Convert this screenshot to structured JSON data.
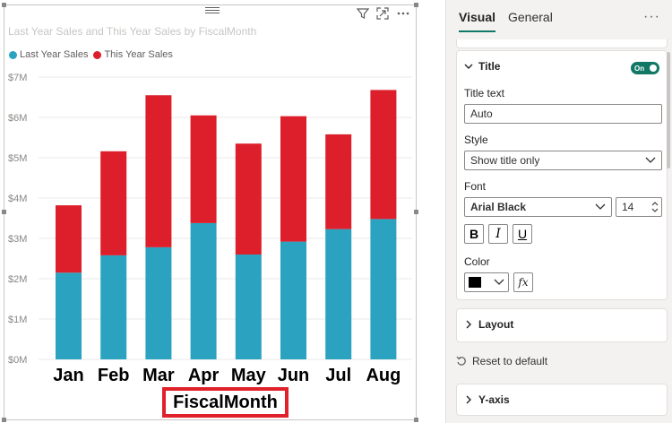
{
  "visual": {
    "title": "Last Year Sales and This Year Sales by FiscalMonth",
    "x_axis_title": "FiscalMonth"
  },
  "icons": {
    "filter": "filter-icon",
    "focus": "focus-mode-icon",
    "more": "more-options-icon",
    "grip": "drag-grip-icon"
  },
  "chart_data": {
    "type": "bar",
    "stacked": true,
    "title": "Last Year Sales and This Year Sales by FiscalMonth",
    "xlabel": "FiscalMonth",
    "ylabel": "",
    "categories": [
      "Jan",
      "Feb",
      "Mar",
      "Apr",
      "May",
      "Jun",
      "Jul",
      "Aug"
    ],
    "series": [
      {
        "name": "Last Year Sales",
        "color": "#2ba3c0",
        "values": [
          2.15,
          2.58,
          2.78,
          3.38,
          2.6,
          2.92,
          3.23,
          3.48
        ]
      },
      {
        "name": "This Year Sales",
        "color": "#dc1f2b",
        "values": [
          1.67,
          2.58,
          3.77,
          2.67,
          2.75,
          3.11,
          2.35,
          3.2
        ]
      }
    ],
    "value_unit": "$M",
    "ylim": [
      0,
      7
    ],
    "yticks": [
      "$0M",
      "$1M",
      "$2M",
      "$3M",
      "$4M",
      "$5M",
      "$6M",
      "$7M"
    ],
    "grid": true,
    "legend_position": "top-left"
  },
  "pane": {
    "tabs": [
      "Visual",
      "General"
    ],
    "more_label": "···",
    "title_section": {
      "header": "Title",
      "toggle_label": "On",
      "title_text_label": "Title text",
      "title_text_value": "Auto",
      "style_label": "Style",
      "style_value": "Show title only",
      "font_label": "Font",
      "font_family_value": "Arial Black",
      "font_size_value": "14",
      "bold_label": "B",
      "italic_label": "I",
      "underline_label": "U",
      "color_label": "Color",
      "color_value": "#000000",
      "fx_label": "fx"
    },
    "layout_header": "Layout",
    "reset_label": "Reset to default",
    "yaxis_header": "Y-axis"
  }
}
